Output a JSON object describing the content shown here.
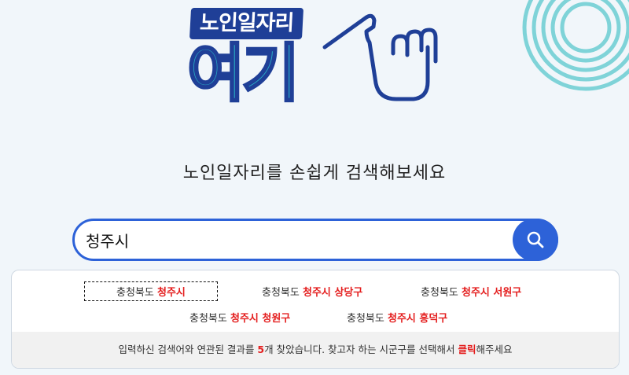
{
  "logo": {
    "top_text": "노인일자리",
    "main_text": "여기",
    "brand_navy": "#1f3f97",
    "brand_teal": "#2ab0c6"
  },
  "tagline": "노인일자리를 손쉽게 검색해보세요",
  "search": {
    "value": "청주시",
    "button_icon": "search-icon",
    "accent": "#2d62d8"
  },
  "results": [
    {
      "prefix": "충청북도 ",
      "highlight": "청주시",
      "selected": true
    },
    {
      "prefix": "충청북도 ",
      "highlight": "청주시 상당구",
      "selected": false
    },
    {
      "prefix": "충청북도 ",
      "highlight": "청주시 서원구",
      "selected": false
    },
    {
      "prefix": "충청북도 ",
      "highlight": "청주시 청원구",
      "selected": false
    },
    {
      "prefix": "충청북도 ",
      "highlight": "청주시 흥덕구",
      "selected": false
    }
  ],
  "footer": {
    "part1": "입력하신 검색어와 연관된 결과를 ",
    "count": "5",
    "part2": "개 찾았습니다. 찾고자 하는 시군구를 선택해서 ",
    "click": "클릭",
    "part3": "해주세요"
  },
  "highlight_color": "#e41e1e"
}
